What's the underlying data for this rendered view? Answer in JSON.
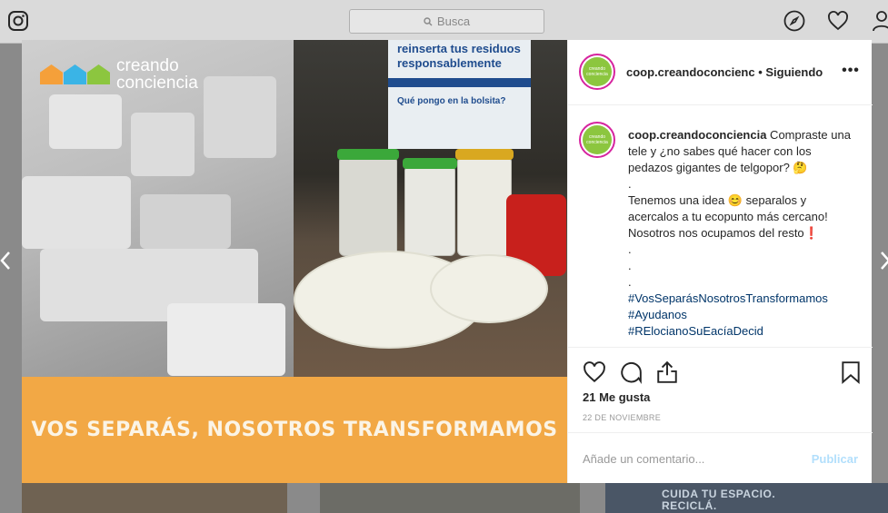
{
  "topbar": {
    "search_placeholder": "Busca",
    "icons": [
      "instagram-icon",
      "search-icon",
      "explore-icon",
      "heart-icon",
      "profile-icon"
    ]
  },
  "post_image": {
    "brand_name_line1": "creando",
    "brand_name_line2": "conciencia",
    "poster_line1": "reinserta tus residuos",
    "poster_line2": "responsablemente",
    "poster_line3": "Qué pongo en la bolsita?",
    "banner_text": "VOS SEPARÁS, NOSOTROS TRANSFORMAMOS",
    "colors": {
      "banner": "#f2a845",
      "house1": "#f5a03a",
      "house2": "#3ab4e6",
      "house3": "#8cc63f"
    }
  },
  "background_posts": {
    "right_post_line1": "CUIDA TU ESPACIO.",
    "right_post_line2": "RECICLÁ."
  },
  "panel": {
    "header": {
      "username": "coop.creandoconcienc",
      "separator": " • ",
      "follow_status": "Siguiendo",
      "more": "•••"
    },
    "caption": {
      "username": "coop.creandoconciencia",
      "lines": [
        " Compraste una tele y ¿no sabes qué hacer con los pedazos gigantes de telgopor? 🤔",
        ".",
        "Tenemos una idea 😊 separalos y acercalos a tu ecopunto más cercano! Nosotros nos ocupamos del resto❗",
        ".",
        ".",
        "."
      ],
      "hashtags": [
        "#VosSeparásNosotrosTransformamos",
        "#Ayudanos",
        "#RElocianoSuEacíaDecid"
      ]
    },
    "likes": "21 Me gusta",
    "date": "22 DE NOVIEMBRE",
    "comment_placeholder": "Añade un comentario...",
    "publish_label": "Publicar"
  }
}
